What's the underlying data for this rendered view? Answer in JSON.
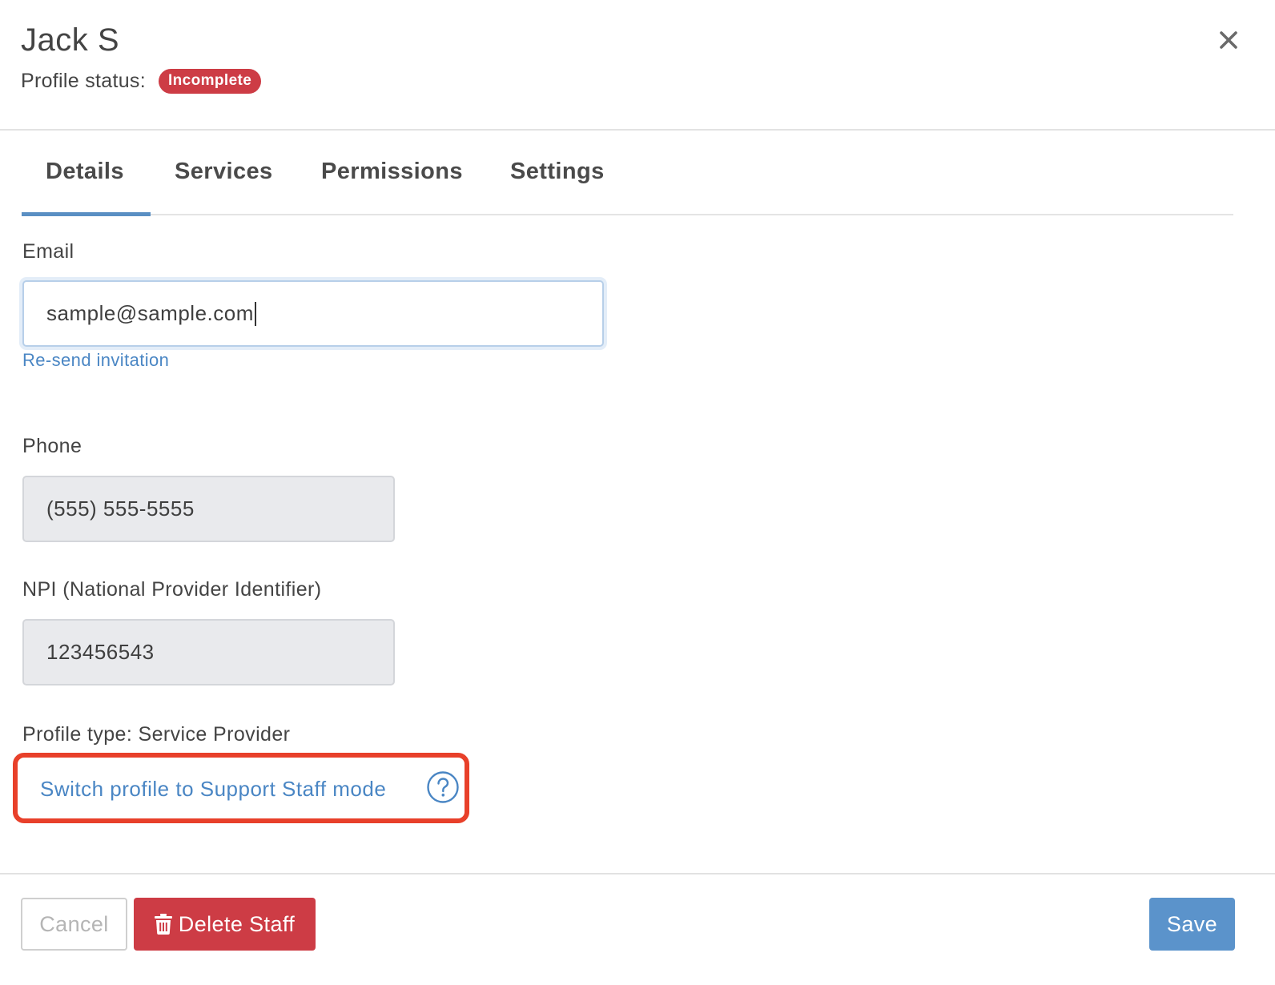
{
  "header": {
    "title": "Jack S",
    "status_label": "Profile status:",
    "status_badge": "Incomplete",
    "close_icon": "close-icon"
  },
  "tabs": [
    {
      "label": "Details",
      "active": true
    },
    {
      "label": "Services",
      "active": false
    },
    {
      "label": "Permissions",
      "active": false
    },
    {
      "label": "Settings",
      "active": false
    }
  ],
  "form": {
    "email": {
      "label": "Email",
      "value": "sample@sample.com",
      "resend_link": "Re-send invitation"
    },
    "phone": {
      "label": "Phone",
      "value": "(555) 555-5555"
    },
    "npi": {
      "label": "NPI (National Provider Identifier)",
      "value": "123456543"
    },
    "profile_type": "Profile type: Service Provider",
    "switch_link": "Switch profile to Support Staff mode",
    "help_icon": "question-circle-icon"
  },
  "footer": {
    "cancel_label": "Cancel",
    "delete_label": "Delete Staff",
    "delete_icon": "trash-icon",
    "save_label": "Save"
  },
  "colors": {
    "accent": "#5a8fc3",
    "link": "#4a86c4",
    "danger": "#cd3c45",
    "highlight": "#e8402a"
  }
}
